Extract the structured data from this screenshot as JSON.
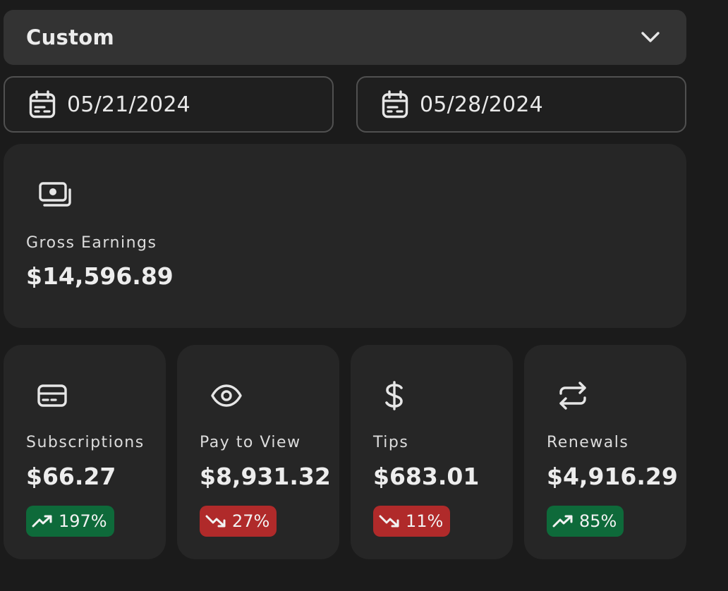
{
  "range": {
    "label": "Custom",
    "icon": "chevron-down-icon"
  },
  "dates": {
    "start": "05/21/2024",
    "end": "05/28/2024",
    "icon": "calendar-icon"
  },
  "gross": {
    "title": "Gross Earnings",
    "value": "$14,596.89",
    "icon": "cash-icon"
  },
  "cards": [
    {
      "title": "Subscriptions",
      "value": "$66.27",
      "change": "197%",
      "trend": "up",
      "icon": "credit-card-icon"
    },
    {
      "title": "Pay to View",
      "value": "$8,931.32",
      "change": "27%",
      "trend": "down",
      "icon": "eye-icon"
    },
    {
      "title": "Tips",
      "value": "$683.01",
      "change": "11%",
      "trend": "down",
      "icon": "dollar-icon"
    },
    {
      "title": "Renewals",
      "value": "$4,916.29",
      "change": "85%",
      "trend": "up",
      "icon": "repeat-icon"
    }
  ],
  "colors": {
    "up": "#0e6a3a",
    "down": "#b02a2a",
    "card": "#262626",
    "background": "#1b1b1b"
  }
}
